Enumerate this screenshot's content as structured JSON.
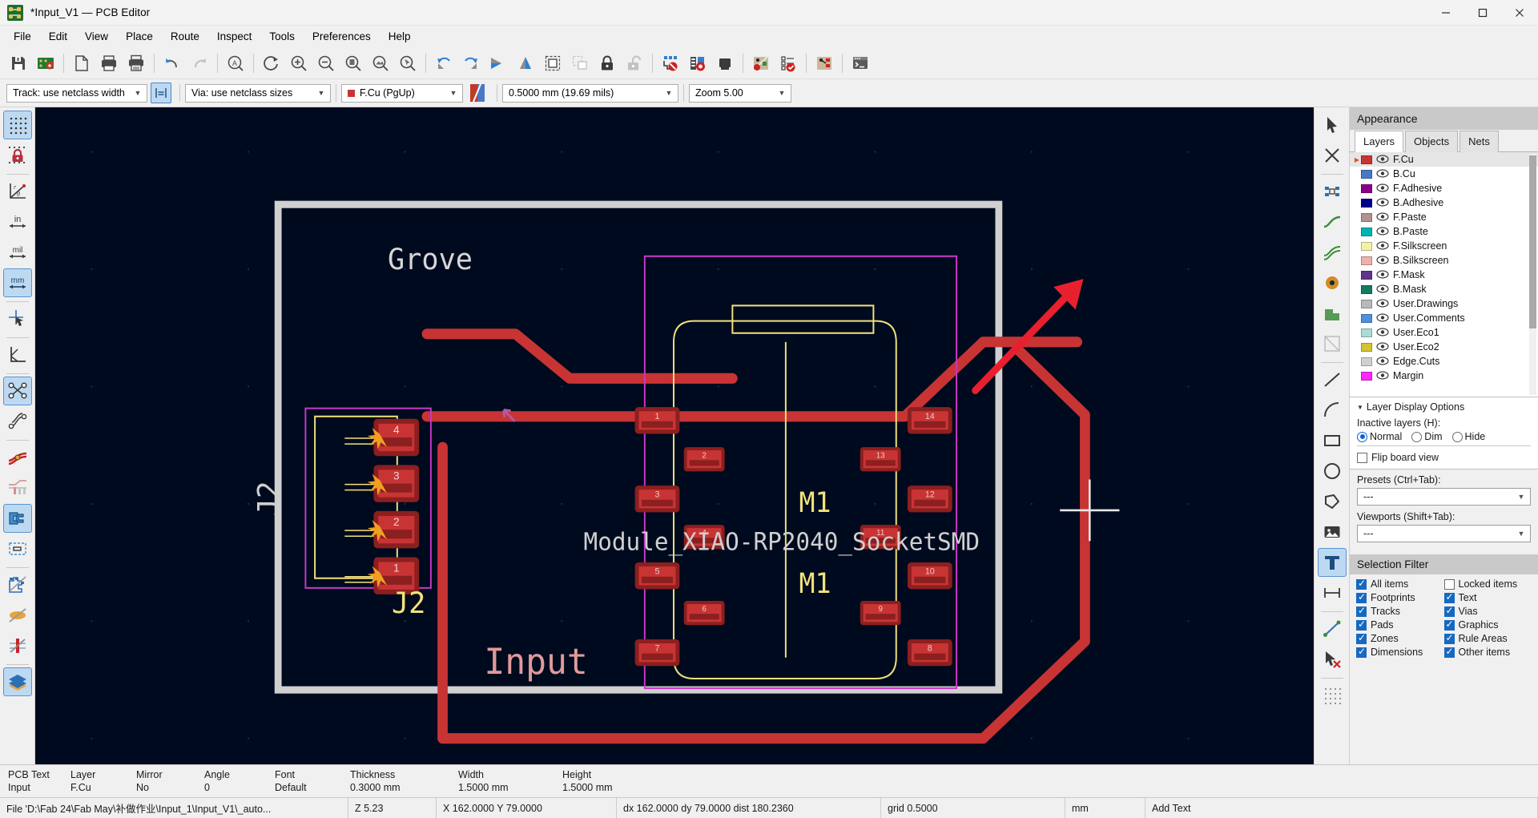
{
  "window": {
    "title": "*Input_V1 — PCB Editor",
    "app_icon": "pcb-board-icon",
    "minimize": "minimize-icon",
    "maximize": "maximize-icon",
    "close": "close-icon"
  },
  "menubar": {
    "items": [
      "File",
      "Edit",
      "View",
      "Place",
      "Route",
      "Inspect",
      "Tools",
      "Preferences",
      "Help"
    ]
  },
  "toolbar": {
    "buttons": [
      {
        "name": "save-icon"
      },
      {
        "name": "board-setup-icon"
      },
      {
        "sep": true
      },
      {
        "name": "page-settings-icon"
      },
      {
        "name": "print-icon"
      },
      {
        "name": "plot-icon"
      },
      {
        "sep": true
      },
      {
        "name": "undo-icon"
      },
      {
        "name": "redo-icon"
      },
      {
        "sep": true
      },
      {
        "name": "find-icon"
      },
      {
        "sep": true
      },
      {
        "name": "refresh-icon"
      },
      {
        "name": "zoom-in-icon"
      },
      {
        "name": "zoom-out-icon"
      },
      {
        "name": "zoom-fit-page-icon"
      },
      {
        "name": "zoom-fit-objects-icon"
      },
      {
        "name": "zoom-to-selection-icon"
      },
      {
        "sep": true
      },
      {
        "name": "rotate-ccw-icon"
      },
      {
        "name": "rotate-cw-icon"
      },
      {
        "name": "flip-horizontal-icon"
      },
      {
        "name": "mirror-vertical-icon"
      },
      {
        "name": "group-icon"
      },
      {
        "name": "ungroup-icon"
      },
      {
        "name": "lock-icon"
      },
      {
        "name": "unlock-icon"
      },
      {
        "sep": true
      },
      {
        "name": "drc-icon"
      },
      {
        "name": "footprint-checker-icon"
      },
      {
        "name": "footprint-library-icon"
      },
      {
        "sep": true
      },
      {
        "name": "netlist-icon"
      },
      {
        "name": "bom-checklist-icon"
      },
      {
        "sep": true
      },
      {
        "name": "update-pcb-icon"
      },
      {
        "sep": true
      },
      {
        "name": "scripting-console-icon"
      }
    ]
  },
  "toolbar2": {
    "track_width": "Track: use netclass width",
    "track_mode_icon": "track-mode-icon",
    "via_size": "Via: use netclass sizes",
    "active_layer": "F.Cu (PgUp)",
    "active_layer_swatch": "#c83434",
    "layer_pair_icon": "layer-pair-icon",
    "grid_size": "0.5000 mm (19.69 mils)",
    "zoom_level": "Zoom 5.00"
  },
  "left_toolbar": {
    "buttons": [
      {
        "name": "grid-toggle-icon",
        "active": true
      },
      {
        "name": "grid-lock-icon",
        "active": false
      },
      {
        "sep_after": true
      },
      {
        "name": "polar-coords-icon",
        "active": false
      },
      {
        "name": "units-inch-icon",
        "active": false
      },
      {
        "name": "units-mil-icon",
        "active": false
      },
      {
        "name": "units-mm-icon",
        "active": true
      },
      {
        "sep_after": true
      },
      {
        "name": "full-crosshair-icon",
        "active": false
      },
      {
        "sep_after": true
      },
      {
        "name": "show-drawing-sheet-icon",
        "active": false
      },
      {
        "sep_after": true
      },
      {
        "name": "show-ratsnest-icon",
        "active": true
      },
      {
        "name": "curved-ratsnest-icon",
        "active": false
      },
      {
        "sep_after": true
      },
      {
        "name": "track-fill-mode-icon",
        "active": false
      },
      {
        "name": "via-fill-mode-icon",
        "active": false
      },
      {
        "name": "pad-fill-mode-icon",
        "active": true
      },
      {
        "name": "zone-outline-mode-icon",
        "active": false
      },
      {
        "sep_after": true
      },
      {
        "name": "show-filled-zones-icon",
        "active": false
      },
      {
        "name": "no-zone-fill-icon",
        "active": false
      },
      {
        "name": "hide-vias-icon",
        "active": false
      },
      {
        "sep_after": true
      },
      {
        "name": "layers-manager-icon",
        "active": true
      }
    ]
  },
  "right_toolbar": {
    "buttons": [
      {
        "name": "select-tool-icon",
        "active": false
      },
      {
        "name": "highlight-net-icon",
        "active": false
      },
      {
        "sep_after": true
      },
      {
        "name": "place-footprint-icon",
        "active": false
      },
      {
        "name": "route-tracks-icon",
        "active": false
      },
      {
        "name": "route-differential-pair-icon",
        "active": false
      },
      {
        "name": "add-via-icon",
        "active": false
      },
      {
        "name": "add-zone-icon",
        "active": false
      },
      {
        "name": "add-rule-area-icon",
        "active": false
      },
      {
        "sep_after": true
      },
      {
        "name": "draw-line-icon",
        "active": false
      },
      {
        "name": "draw-arc-icon",
        "active": false
      },
      {
        "name": "draw-rectangle-icon",
        "active": false
      },
      {
        "name": "draw-circle-icon",
        "active": false
      },
      {
        "name": "draw-polygon-icon",
        "active": false
      },
      {
        "name": "add-image-icon",
        "active": false
      },
      {
        "name": "add-text-icon",
        "active": true
      },
      {
        "name": "add-dimension-icon",
        "active": false
      },
      {
        "sep_after": true
      },
      {
        "name": "measure-tool-icon",
        "active": false
      },
      {
        "name": "delete-tool-icon",
        "active": false
      },
      {
        "sep_after": true
      },
      {
        "name": "set-origin-icon",
        "active": false
      }
    ]
  },
  "appearance": {
    "title": "Appearance",
    "tabs": [
      {
        "label": "Layers",
        "active": true
      },
      {
        "label": "Objects",
        "active": false
      },
      {
        "label": "Nets",
        "active": false
      }
    ],
    "layers": [
      {
        "name": "F.Cu",
        "color": "#c83434",
        "selected": true
      },
      {
        "name": "B.Cu",
        "color": "#4979c4",
        "selected": false
      },
      {
        "name": "F.Adhesive",
        "color": "#8b008b",
        "selected": false
      },
      {
        "name": "B.Adhesive",
        "color": "#00008b",
        "selected": false
      },
      {
        "name": "F.Paste",
        "color": "#b09490",
        "selected": false
      },
      {
        "name": "B.Paste",
        "color": "#00b3b3",
        "selected": false
      },
      {
        "name": "F.Silkscreen",
        "color": "#f2f2a6",
        "selected": false
      },
      {
        "name": "B.Silkscreen",
        "color": "#eeb0aa",
        "selected": false
      },
      {
        "name": "F.Mask",
        "color": "#62338c",
        "selected": false
      },
      {
        "name": "B.Mask",
        "color": "#127c62",
        "selected": false
      },
      {
        "name": "User.Drawings",
        "color": "#b8b8b8",
        "selected": false
      },
      {
        "name": "User.Comments",
        "color": "#4d90e0",
        "selected": false
      },
      {
        "name": "User.Eco1",
        "color": "#aadcd5",
        "selected": false
      },
      {
        "name": "User.Eco2",
        "color": "#d2c431",
        "selected": false
      },
      {
        "name": "Edge.Cuts",
        "color": "#d0d0d0",
        "selected": false
      },
      {
        "name": "Margin",
        "color": "#ff26ff",
        "selected": false
      }
    ],
    "layer_display_options": {
      "header": "Layer Display Options",
      "inactive_label": "Inactive layers (H):",
      "radios": [
        {
          "label": "Normal",
          "selected": true
        },
        {
          "label": "Dim",
          "selected": false
        },
        {
          "label": "Hide",
          "selected": false
        }
      ],
      "flip_board_view": {
        "label": "Flip board view",
        "checked": false
      }
    },
    "presets": {
      "label": "Presets (Ctrl+Tab):",
      "value": "---"
    },
    "viewports": {
      "label": "Viewports (Shift+Tab):",
      "value": "---"
    }
  },
  "selection_filter": {
    "title": "Selection Filter",
    "items": [
      {
        "label": "All items",
        "checked": true
      },
      {
        "label": "Locked items",
        "checked": false
      },
      {
        "label": "Footprints",
        "checked": true
      },
      {
        "label": "Text",
        "checked": true
      },
      {
        "label": "Tracks",
        "checked": true
      },
      {
        "label": "Vias",
        "checked": true
      },
      {
        "label": "Pads",
        "checked": true
      },
      {
        "label": "Graphics",
        "checked": true
      },
      {
        "label": "Zones",
        "checked": true
      },
      {
        "label": "Rule Areas",
        "checked": true
      },
      {
        "label": "Dimensions",
        "checked": true
      },
      {
        "label": "Other items",
        "checked": true
      }
    ]
  },
  "properties_bar": {
    "columns": [
      {
        "key": "PCB Text",
        "value": "Input"
      },
      {
        "key": "Layer",
        "value": "F.Cu"
      },
      {
        "key": "Mirror",
        "value": "No"
      },
      {
        "key": "Angle",
        "value": "0"
      },
      {
        "key": "Font",
        "value": "Default"
      },
      {
        "key": "Thickness",
        "value": "0.3000 mm"
      },
      {
        "key": "Width",
        "value": "1.5000 mm"
      },
      {
        "key": "Height",
        "value": "1.5000 mm"
      }
    ]
  },
  "statusbar": {
    "file": "File 'D:\\Fab 24\\Fab May\\补做作业\\Input_1\\Input_V1\\_auto...",
    "zoom": "Z 5.23",
    "coords": "X 162.0000  Y 79.0000",
    "delta": "dx 162.0000  dy 79.0000  dist 180.2360",
    "grid": "grid 0.5000",
    "units": "mm",
    "tool": "Add Text"
  },
  "canvas": {
    "background": "#000a1e",
    "board_outline_color": "#d0d0d0",
    "silkscreen_color": "#f2f2a6",
    "copper_color": "#c83434",
    "labels": [
      {
        "text": "Grove",
        "color": "#d6d6d6"
      },
      {
        "text": "J2",
        "color": "#d6d6d6"
      },
      {
        "text": "J2",
        "color": "#f2e27a"
      },
      {
        "text": "Input",
        "color": "#e09a9a"
      },
      {
        "text": "M1",
        "color": "#f2e27a"
      },
      {
        "text": "M1",
        "color": "#f2e27a"
      },
      {
        "text": "Module_XIAO-RP2040_SocketSMD",
        "color": "#d6d6d6"
      }
    ],
    "connector_pads": [
      "4",
      "3",
      "2",
      "1"
    ],
    "module_pads_left": [
      "1",
      "3",
      "5",
      "7"
    ],
    "module_pads_inner_left": [
      "2",
      "4",
      "6"
    ],
    "module_pads_right": [
      "14",
      "13",
      "12",
      "11",
      "10",
      "8"
    ],
    "module_pads_inner_right": [
      "9"
    ],
    "cursor_crosshair": "crosshair-cursor",
    "annotation_arrow_color": "#e8202e"
  }
}
